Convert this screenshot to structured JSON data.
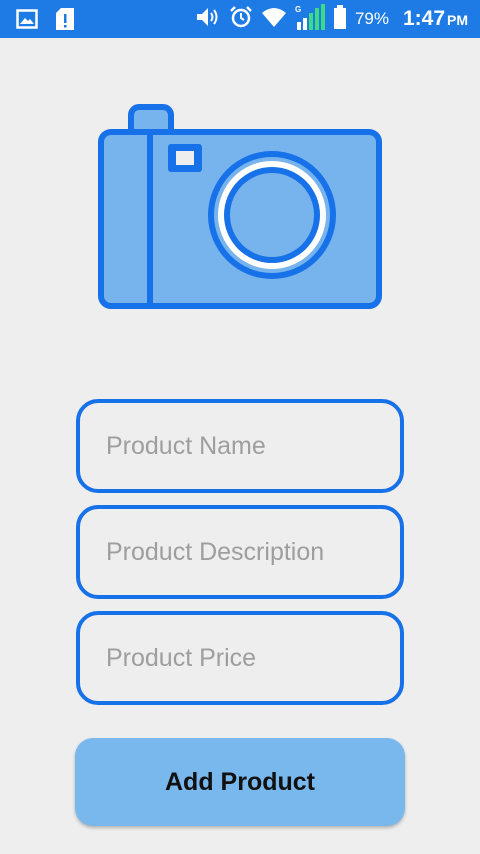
{
  "status_bar": {
    "battery_percent": "79%",
    "time": "1:47",
    "ampm": "PM",
    "icons": [
      "image-icon",
      "sd-card-alert-icon",
      "volume-icon",
      "alarm-icon",
      "wifi-icon",
      "signal-icon",
      "battery-icon"
    ]
  },
  "form": {
    "product_name_placeholder": "Product Name",
    "product_description_placeholder": "Product Description",
    "product_price_placeholder": "Product Price",
    "submit_label": "Add Product"
  },
  "colors": {
    "status_bar": "#1e7be6",
    "accent_border": "#1771e8",
    "camera_fill": "#77b3ec",
    "button_fill": "#78b8ec",
    "background": "#eeeeee"
  }
}
